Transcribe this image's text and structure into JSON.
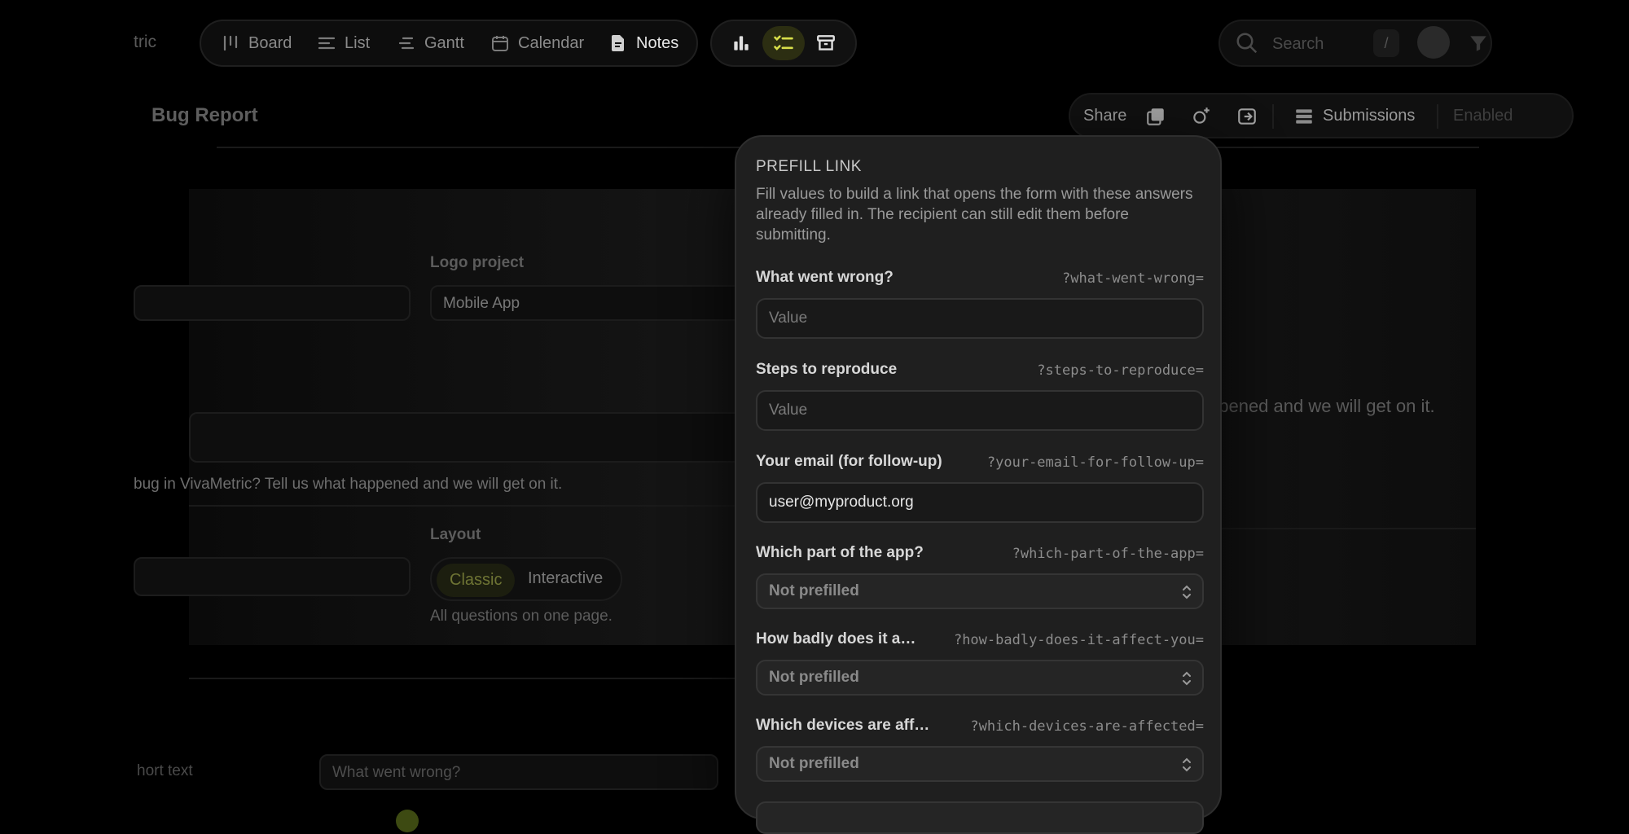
{
  "topbar": {
    "brand_fragment": "tric",
    "views": [
      {
        "label": "Board",
        "icon": "board-icon"
      },
      {
        "label": "List",
        "icon": "list-icon"
      },
      {
        "label": "Gantt",
        "icon": "gantt-icon"
      },
      {
        "label": "Calendar",
        "icon": "calendar-icon"
      },
      {
        "label": "Notes",
        "icon": "notes-icon",
        "active": true
      }
    ],
    "tools": [
      {
        "icon": "bar-chart-icon"
      },
      {
        "icon": "checklist-icon",
        "active": true
      },
      {
        "icon": "archive-icon"
      }
    ],
    "search_placeholder": "Search",
    "search_shortcut": "/"
  },
  "page": {
    "title_fragment": "Bug Report",
    "share_label": "Share",
    "submissions_label": "Submissions",
    "enabled_fragment": "Enabled"
  },
  "background_form": {
    "project_label": "Logo project",
    "project_value": "Mobile App",
    "description_fragment": "bug in VivaMetric? Tell us what happened and we will get on it.",
    "description_right_fragment": "ppened and we will get on it.",
    "layout_label": "Layout",
    "layout_options": [
      "Classic",
      "Interactive"
    ],
    "layout_active": "Classic",
    "layout_hint": "All questions on one page.",
    "field_type_fragment": "hort text",
    "question_placeholder": "What went wrong?"
  },
  "prefill": {
    "heading": "PREFILL LINK",
    "description": "Fill values to build a link that opens the form with these answers already filled in. The recipient can still edit them before submitting.",
    "questions": [
      {
        "label": "What went wrong?",
        "param": "?what-went-wrong=",
        "kind": "text",
        "placeholder": "Value",
        "value": ""
      },
      {
        "label": "Steps to reproduce",
        "param": "?steps-to-reproduce=",
        "kind": "text",
        "placeholder": "Value",
        "value": ""
      },
      {
        "label": "Your email (for follow-up)",
        "param": "?your-email-for-follow-up=",
        "kind": "text",
        "placeholder": "",
        "value": "user@myproduct.org"
      },
      {
        "label": "Which part of the app?",
        "param": "?which-part-of-the-app=",
        "kind": "select",
        "value": "Not prefilled"
      },
      {
        "label": "How badly does it a…",
        "param": "?how-badly-does-it-affect-you=",
        "kind": "select",
        "value": "Not prefilled"
      },
      {
        "label": "Which devices are aff…",
        "param": "?which-devices-are-affected=",
        "kind": "select",
        "value": "Not prefilled"
      }
    ]
  }
}
